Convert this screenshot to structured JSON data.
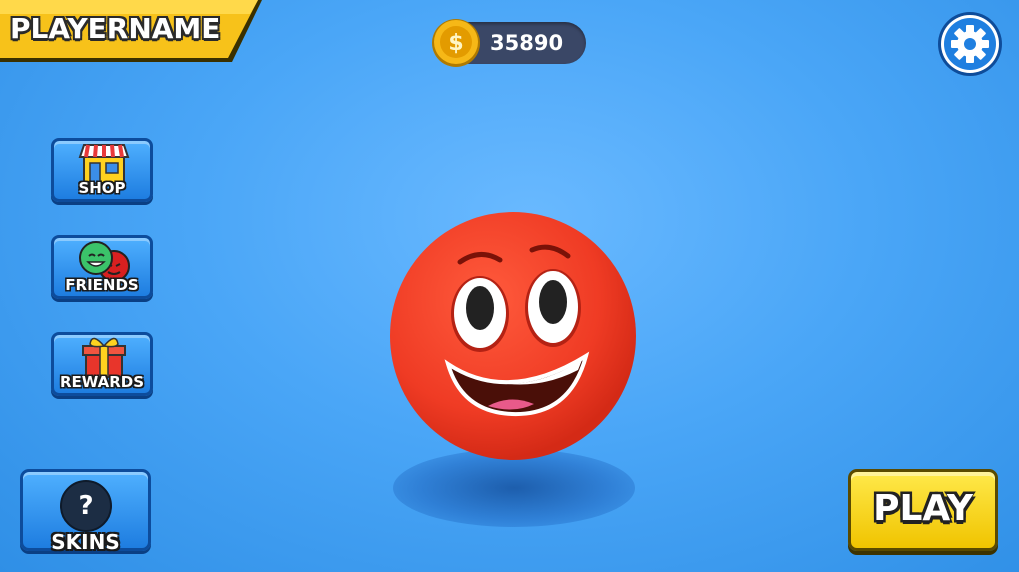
{
  "player": {
    "name": "PLAYERNAME"
  },
  "currency": {
    "amount": "35890",
    "icon": "gold-coin-icon",
    "symbol": "$"
  },
  "settings": {
    "icon": "gear-icon"
  },
  "menu": [
    {
      "id": "shop",
      "label": "SHOP",
      "icon": "shop-icon"
    },
    {
      "id": "friends",
      "label": "FRIENDS",
      "icon": "friends-icon"
    },
    {
      "id": "rewards",
      "label": "REWARDS",
      "icon": "gift-icon"
    }
  ],
  "skins": {
    "label": "SKINS",
    "icon_text": "?"
  },
  "play": {
    "label": "PLAY"
  },
  "colors": {
    "background": "#4aa6f7",
    "ball": "#ef3b24",
    "banner": "#f7c21a",
    "play_button": "#ffe94a",
    "menu_button": "#2f8fee"
  }
}
